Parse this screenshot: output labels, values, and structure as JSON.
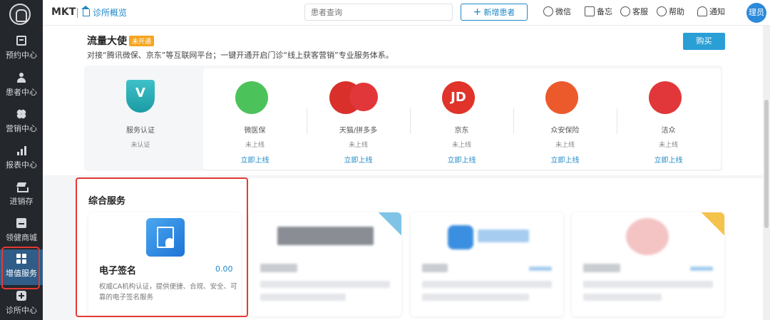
{
  "sidebar": {
    "items": [
      {
        "label": "预约中心",
        "icon": "calendar-icon"
      },
      {
        "label": "患者中心",
        "icon": "user-icon"
      },
      {
        "label": "营销中心",
        "icon": "flower-icon"
      },
      {
        "label": "报表中心",
        "icon": "bar-chart-icon"
      },
      {
        "label": "进销存",
        "icon": "layers-icon"
      },
      {
        "label": "领健商城",
        "icon": "shop-icon"
      },
      {
        "label": "增值服务",
        "icon": "grid-icon",
        "active": true
      },
      {
        "label": "诊所中心",
        "icon": "clinic-plus-icon"
      }
    ]
  },
  "topbar": {
    "app_name": "MKT",
    "home_link": "诊所概览",
    "search_placeholder": "患者查询",
    "add_patient": "新增患者",
    "tools": [
      "微信",
      "备忘",
      "客服",
      "帮助",
      "通知"
    ],
    "avatar_text": "理员"
  },
  "traffic": {
    "title": "流量大使",
    "badge": "未开通",
    "description": "对接“腾讯微保、京东”等互联网平台；一键开通开启门诊“线上获客营销”专业服务体系。",
    "buy_label": "购买",
    "auth_card": {
      "name": "服务认证",
      "status": "未认证"
    },
    "platforms": [
      {
        "name": "微医保",
        "status": "未上线",
        "link": "立即上线",
        "color": "#4cc25b"
      },
      {
        "name": "天猫/拼多多",
        "status": "未上线",
        "link": "立即上线",
        "color": "#d9302c"
      },
      {
        "name": "京东",
        "status": "未上线",
        "link": "立即上线",
        "color": "#e0332a"
      },
      {
        "name": "众安保险",
        "status": "未上线",
        "link": "立即上线",
        "color": "#ec5a2c"
      },
      {
        "name": "洁众",
        "status": "未上线",
        "link": "立即上线",
        "color": "#e2373a"
      }
    ]
  },
  "services": {
    "title": "综合服务",
    "esign": {
      "name": "电子签名",
      "price": "0.00",
      "description": "权威CA机构认证，提供便捷、合规、安全、可靠的电子签名服务"
    }
  },
  "colors": {
    "accent": "#1e88c7",
    "sidebar_bg": "#24272c",
    "highlight": "#e53935"
  }
}
